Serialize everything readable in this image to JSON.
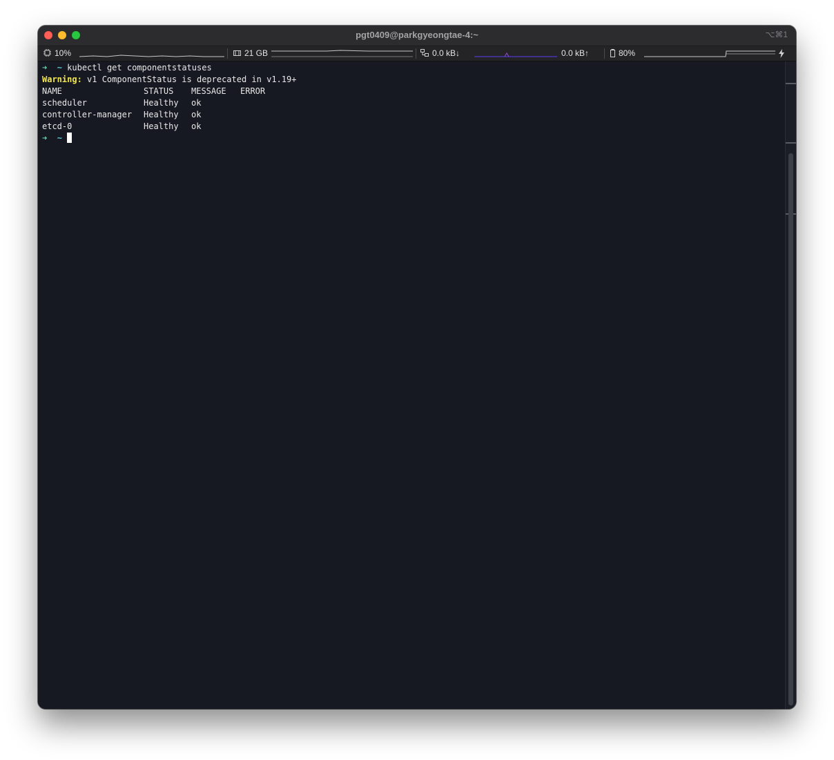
{
  "window": {
    "title": "pgt0409@parkgyeongtae-4:~",
    "shortcut": "⌥⌘1"
  },
  "statusbar": {
    "cpu": {
      "icon": "cpu-icon",
      "value": "10%"
    },
    "memory": {
      "icon": "memory-icon",
      "value": "21 GB"
    },
    "network": {
      "icon": "network-icon",
      "down": "0.0 kB↓",
      "up": "0.0 kB↑"
    },
    "battery": {
      "icon": "battery-icon",
      "value": "80%",
      "level": 0.8
    },
    "charging": {
      "icon": "lightning-icon"
    }
  },
  "terminal": {
    "prompt_arrow": "➜",
    "prompt_dir": "~",
    "command": "kubectl get componentstatuses",
    "warning_label": "Warning:",
    "warning_text": " v1 ComponentStatus is deprecated in v1.19+",
    "table": {
      "headers": [
        "NAME",
        "STATUS",
        "MESSAGE",
        "ERROR"
      ],
      "rows": [
        [
          "scheduler",
          "Healthy",
          "ok",
          ""
        ],
        [
          "controller-manager",
          "Healthy",
          "ok",
          ""
        ],
        [
          "etcd-0",
          "Healthy",
          "ok",
          ""
        ]
      ]
    }
  },
  "colors": {
    "terminal_bg": "#161922",
    "prompt_arrow": "#5ed8a8",
    "prompt_dir": "#59c8d6",
    "warning": "#f3e74b",
    "graph_cpu": "#c8c8cc",
    "graph_net_down": "#5b3df5",
    "graph_net_up": "#9b4bd8"
  }
}
